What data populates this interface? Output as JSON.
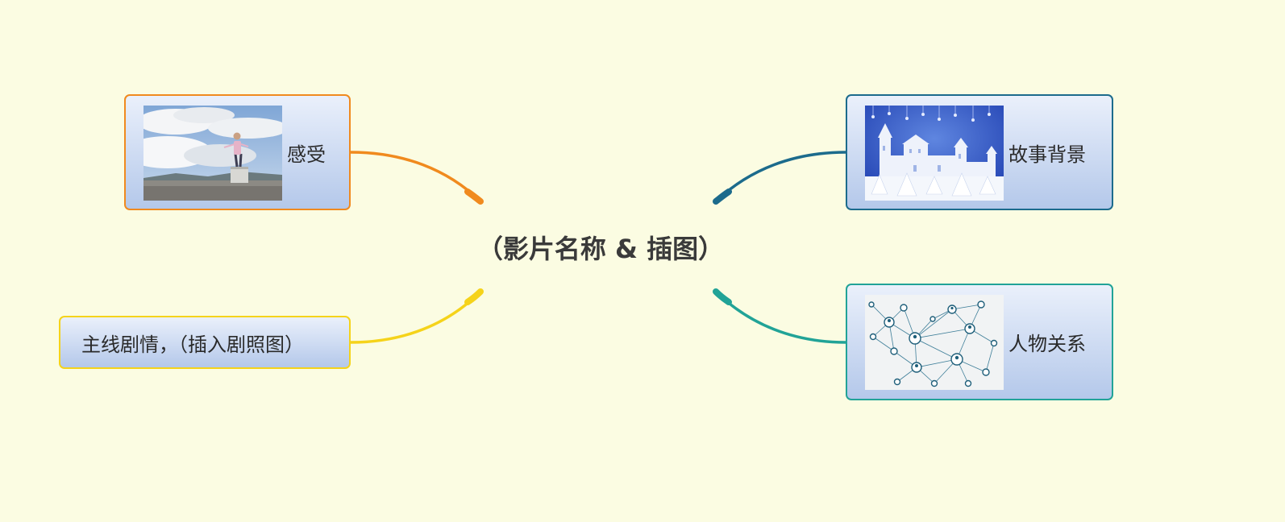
{
  "central_topic": {
    "label": "（影片名称 & 插图）"
  },
  "topics": {
    "feeling": {
      "label": "感受",
      "color": "#f08a1e",
      "image": "person-on-pedestal-landscape"
    },
    "plot": {
      "label": "主线剧情，（插入剧照图）",
      "color": "#f5d31a"
    },
    "background": {
      "label": "故事背景",
      "color": "#1c6b8c",
      "image": "snow-castle-illustration"
    },
    "relations": {
      "label": "人物关系",
      "color": "#21a397",
      "image": "people-network-illustration"
    }
  }
}
